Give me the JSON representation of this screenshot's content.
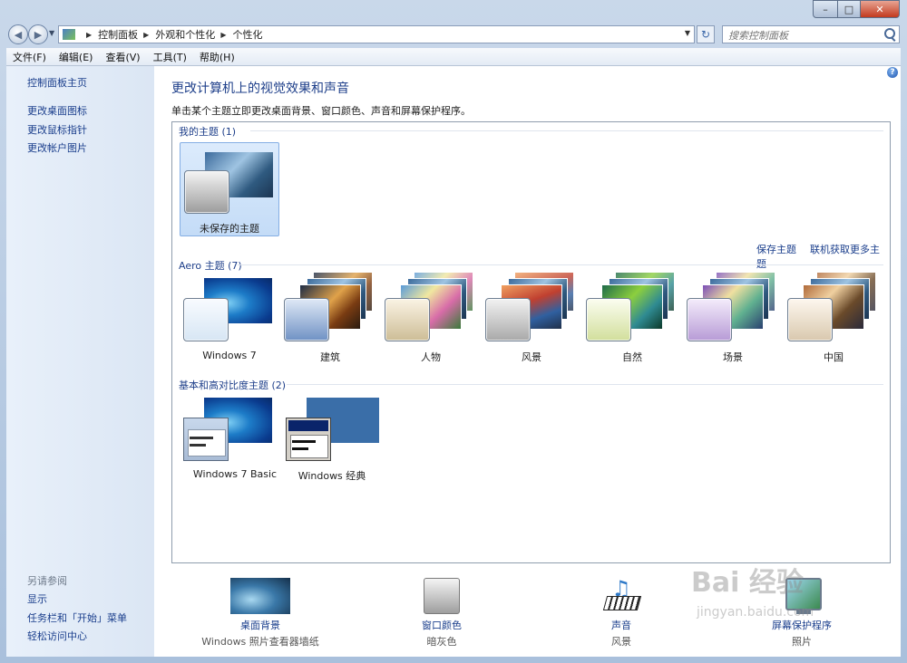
{
  "window": {
    "caption": {
      "minimize": "–",
      "maximize": "□",
      "close": "✕"
    }
  },
  "address": {
    "breadcrumb": [
      "控制面板",
      "外观和个性化",
      "个性化"
    ],
    "search_placeholder": "搜索控制面板"
  },
  "menu": [
    "文件(F)",
    "编辑(E)",
    "查看(V)",
    "工具(T)",
    "帮助(H)"
  ],
  "left": {
    "home": "控制面板主页",
    "links": [
      "更改桌面图标",
      "更改鼠标指针",
      "更改帐户图片"
    ],
    "see_also_title": "另请参阅",
    "see_also": [
      "显示",
      "任务栏和「开始」菜单",
      "轻松访问中心"
    ]
  },
  "main": {
    "title": "更改计算机上的视觉效果和声音",
    "subtitle": "单击某个主题立即更改桌面背景、窗口颜色、声音和屏幕保护程序。",
    "my_themes": {
      "title": "我的主题 (1)",
      "items": [
        {
          "label": "未保存的主题",
          "selected": true
        }
      ]
    },
    "actions": {
      "save": "保存主题",
      "online": "联机获取更多主题"
    },
    "aero_themes": {
      "title": "Aero 主题 (7)",
      "items": [
        "Windows 7",
        "建筑",
        "人物",
        "风景",
        "自然",
        "场景",
        "中国"
      ]
    },
    "basic_themes": {
      "title": "基本和高对比度主题 (2)",
      "items": [
        "Windows 7 Basic",
        "Windows 经典"
      ]
    }
  },
  "settings": [
    {
      "label": "桌面背景",
      "value": "Windows 照片查看器墙纸",
      "icon": "wallpaper-icon"
    },
    {
      "label": "窗口颜色",
      "value": "暗灰色",
      "icon": "window-color-icon"
    },
    {
      "label": "声音",
      "value": "风景",
      "icon": "sound-icon"
    },
    {
      "label": "屏幕保护程序",
      "value": "照片",
      "icon": "screensaver-icon"
    }
  ],
  "watermark": {
    "logo": "Bai 经验",
    "url": "jingyan.baidu.com"
  }
}
